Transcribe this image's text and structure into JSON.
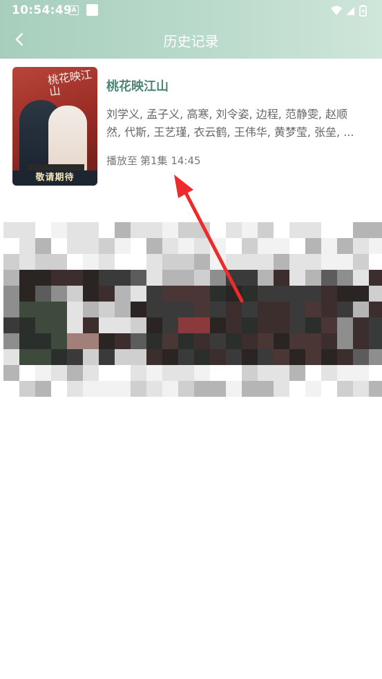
{
  "status_bar": {
    "time": "10:54:49",
    "notification_letter": "A",
    "icons": [
      "wifi-icon",
      "signal-icon",
      "battery-icon"
    ]
  },
  "header": {
    "title": "历史记录",
    "back_icon": "chevron-left-icon"
  },
  "history": [
    {
      "title": "桃花映江山",
      "cast_line_1": "刘学义, 孟子义, 高寒, 刘令姿, 边程, 范静雯, 赵顺",
      "cast_line_2": "然, 代斯, 王艺瑾, 衣云鹤, 王伟华, 黄梦莹, 张垒, ...",
      "progress_label": "播放至",
      "progress_value": "第1集 14:45",
      "poster_text": "敬请期待",
      "poster_calligraphy": "桃花映江山"
    }
  ],
  "colors": {
    "header_start": "#a7cebd",
    "header_end": "#cfe6da",
    "title_accent": "#4c8577",
    "annotation_arrow": "#ee2a2a"
  }
}
